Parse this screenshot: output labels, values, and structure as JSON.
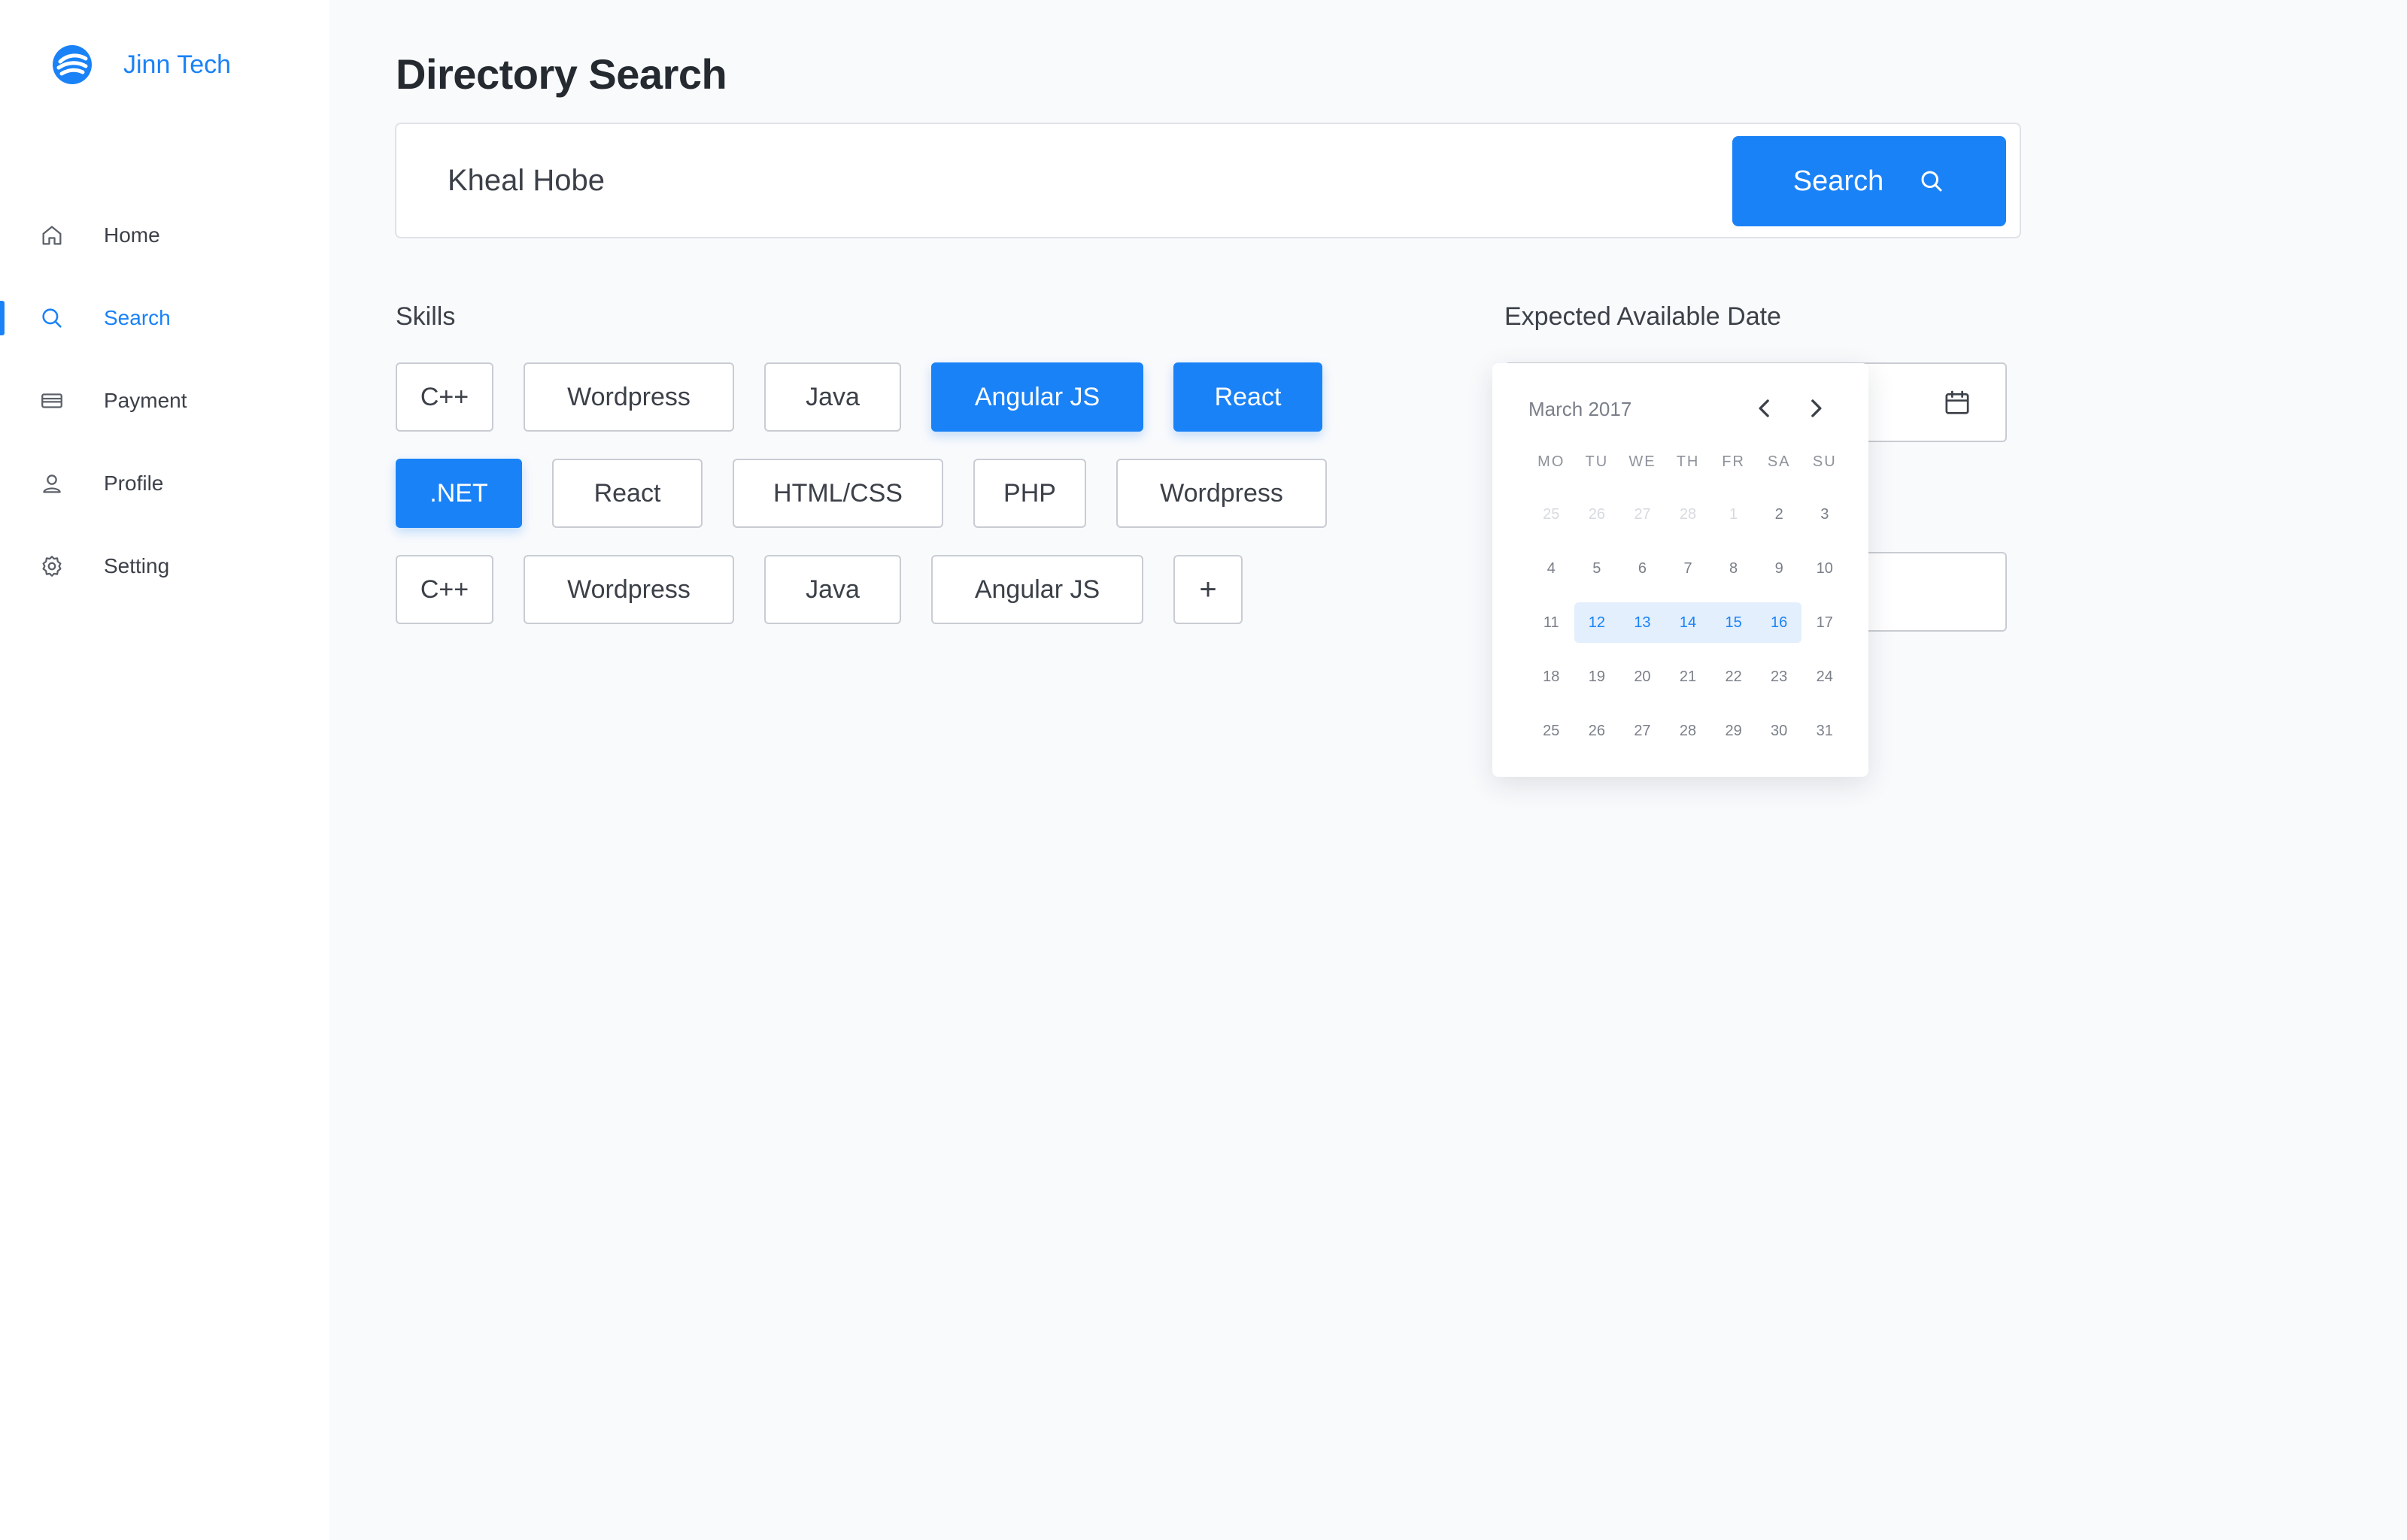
{
  "brand": {
    "name": "Jinn Tech",
    "logo_icon": "brand-swoosh-logo",
    "color": "#1a82f7"
  },
  "sidebar": {
    "items": [
      {
        "label": "Home",
        "icon": "home-icon",
        "active": false
      },
      {
        "label": "Search",
        "icon": "search-icon",
        "active": true
      },
      {
        "label": "Payment",
        "icon": "credit-card-icon",
        "active": false
      },
      {
        "label": "Profile",
        "icon": "user-icon",
        "active": false
      },
      {
        "label": "Setting",
        "icon": "gear-icon",
        "active": false
      }
    ]
  },
  "main": {
    "title": "Directory Search",
    "search": {
      "value": "Kheal Hobe",
      "button_label": "Search"
    },
    "skills": {
      "label": "Skills",
      "rows": [
        [
          {
            "label": "C++",
            "selected": false
          },
          {
            "label": "Wordpress",
            "selected": false
          },
          {
            "label": "Java",
            "selected": false
          },
          {
            "label": "Angular JS",
            "selected": true
          },
          {
            "label": "React",
            "selected": true
          }
        ],
        [
          {
            "label": ".NET",
            "selected": true
          },
          {
            "label": "React",
            "selected": false
          },
          {
            "label": "HTML/CSS",
            "selected": false
          },
          {
            "label": "PHP",
            "selected": false
          },
          {
            "label": "Wordpress",
            "selected": false
          }
        ],
        [
          {
            "label": "C++",
            "selected": false
          },
          {
            "label": "Wordpress",
            "selected": false
          },
          {
            "label": "Java",
            "selected": false
          },
          {
            "label": "Angular JS",
            "selected": false
          }
        ]
      ],
      "add_label": "+"
    },
    "date": {
      "label": "Expected Available Date",
      "calendar": {
        "title": "March 2017",
        "weekdays": [
          "MO",
          "TU",
          "WE",
          "TH",
          "FR",
          "SA",
          "SU"
        ],
        "weeks": [
          [
            {
              "d": "25",
              "muted": true
            },
            {
              "d": "26",
              "muted": true
            },
            {
              "d": "27",
              "muted": true
            },
            {
              "d": "28",
              "muted": true
            },
            {
              "d": "1",
              "muted": true
            },
            {
              "d": "2"
            },
            {
              "d": "3"
            }
          ],
          [
            {
              "d": "4"
            },
            {
              "d": "5"
            },
            {
              "d": "6"
            },
            {
              "d": "7"
            },
            {
              "d": "8"
            },
            {
              "d": "9"
            },
            {
              "d": "10"
            }
          ],
          [
            {
              "d": "11"
            },
            {
              "d": "12",
              "range": true
            },
            {
              "d": "13",
              "range": true
            },
            {
              "d": "14",
              "range": true
            },
            {
              "d": "15",
              "range": true
            },
            {
              "d": "16",
              "range": true
            },
            {
              "d": "17"
            }
          ],
          [
            {
              "d": "18"
            },
            {
              "d": "19"
            },
            {
              "d": "20"
            },
            {
              "d": "21"
            },
            {
              "d": "22"
            },
            {
              "d": "23"
            },
            {
              "d": "24"
            }
          ],
          [
            {
              "d": "25"
            },
            {
              "d": "26"
            },
            {
              "d": "27"
            },
            {
              "d": "28"
            },
            {
              "d": "29"
            },
            {
              "d": "30"
            },
            {
              "d": "31"
            }
          ]
        ]
      }
    }
  },
  "colors": {
    "accent": "#1a82f7",
    "range_fill": "#e3effd",
    "page_bg": "#f9fafc",
    "border": "#c9ccd3"
  }
}
